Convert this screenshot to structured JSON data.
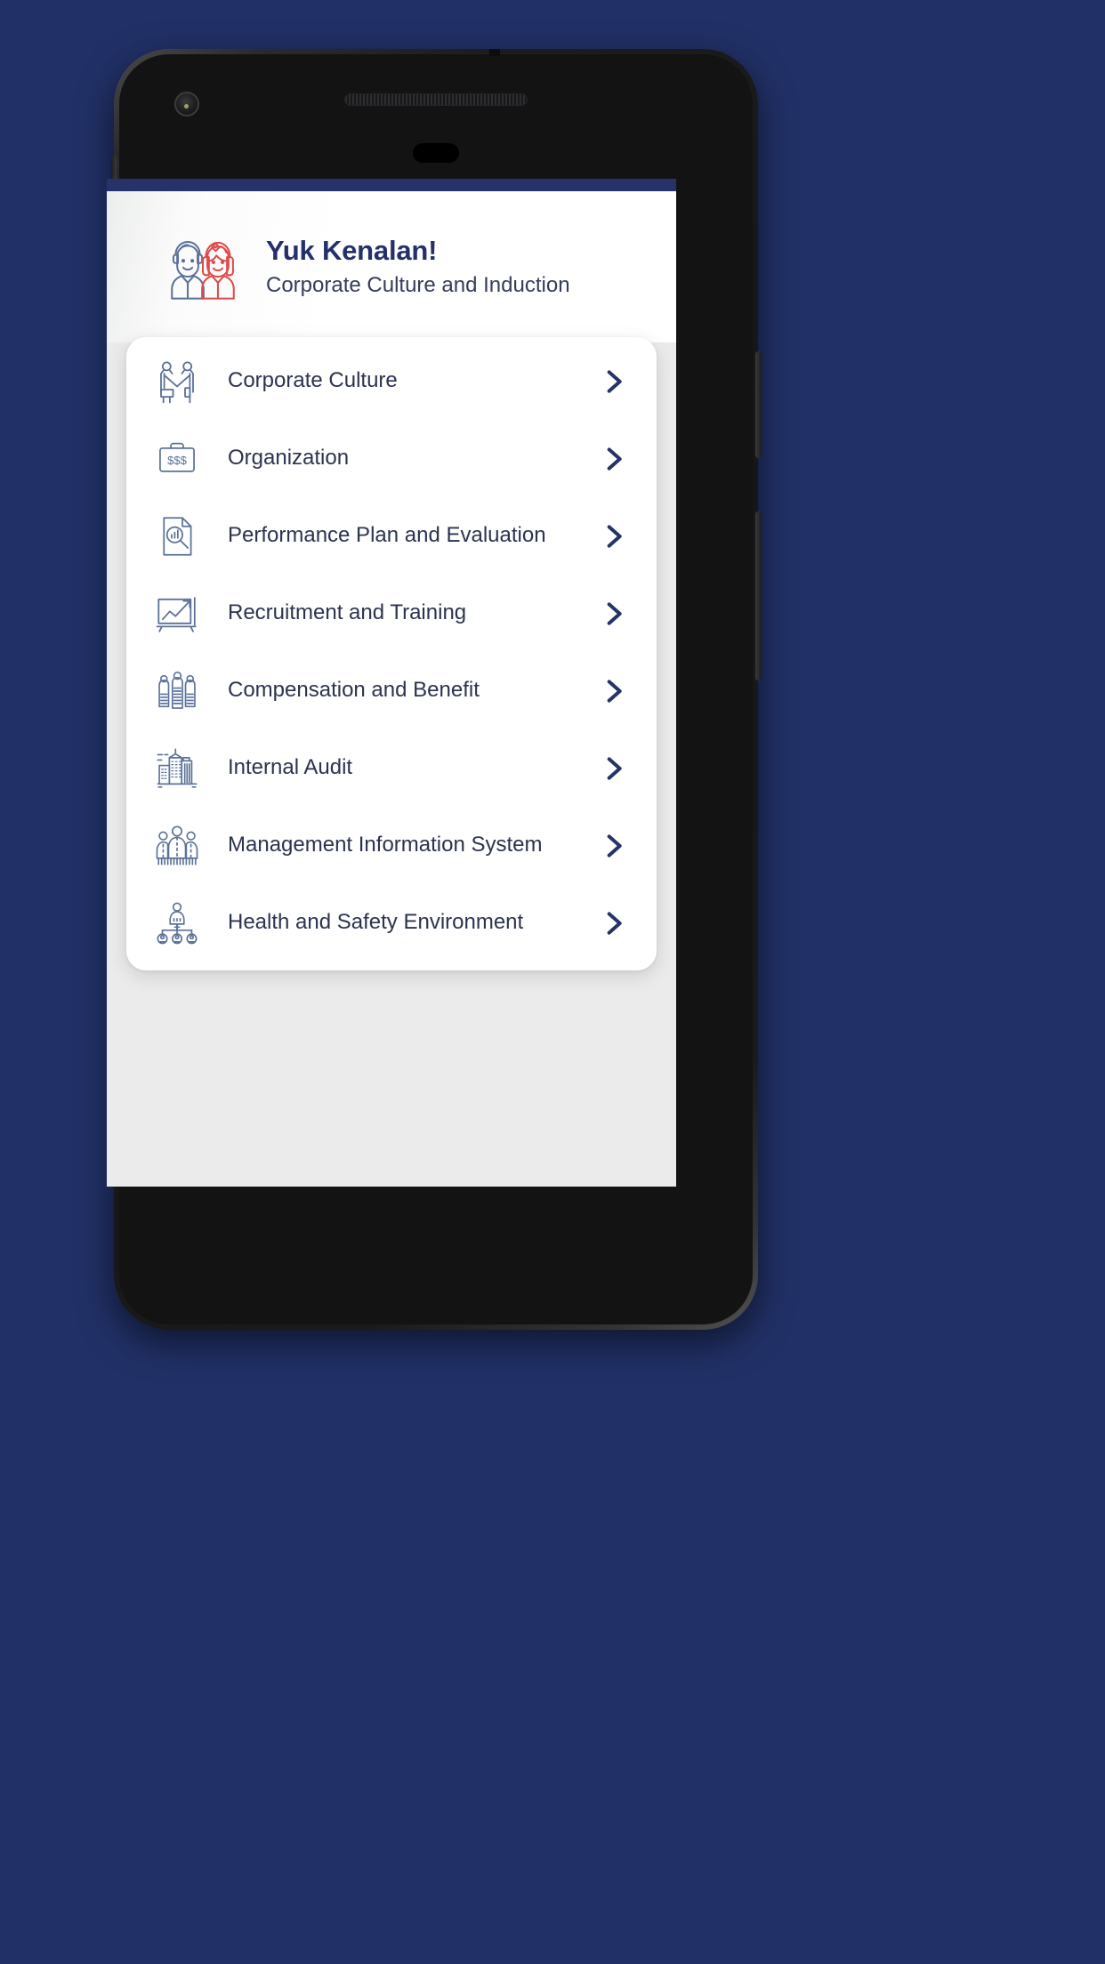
{
  "background_color": "#213066",
  "device": {
    "frame_color": "#1a1a1c",
    "camera_icon": "camera-lens-icon",
    "speaker_icon": "earpiece-speaker-icon",
    "sensor_icon": "proximity-sensor-icon"
  },
  "status_bar": {
    "color": "#27326b"
  },
  "header": {
    "illustration_icon": "two-people-avatars-icon",
    "title": "Yuk Kenalan!",
    "subtitle": "Corporate Culture and Induction",
    "title_color": "#23306b",
    "subtitle_color": "#343c5c"
  },
  "menu": {
    "chevron_icon": "chevron-right-icon",
    "chevron_color": "#243565",
    "icon_color": "#5b7199",
    "items": [
      {
        "label": "Corporate Culture",
        "icon": "handshake-people-icon"
      },
      {
        "label": "Organization",
        "icon": "briefcase-money-icon"
      },
      {
        "label": "Performance Plan and Evaluation",
        "icon": "document-search-chart-icon"
      },
      {
        "label": "Recruitment and Training",
        "icon": "growth-chart-board-icon"
      },
      {
        "label": "Compensation and Benefit",
        "icon": "three-people-money-icon"
      },
      {
        "label": "Internal Audit",
        "icon": "office-buildings-icon"
      },
      {
        "label": "Management Information System",
        "icon": "team-group-icon"
      },
      {
        "label": "Health and Safety Environment",
        "icon": "org-hierarchy-people-icon"
      }
    ]
  }
}
